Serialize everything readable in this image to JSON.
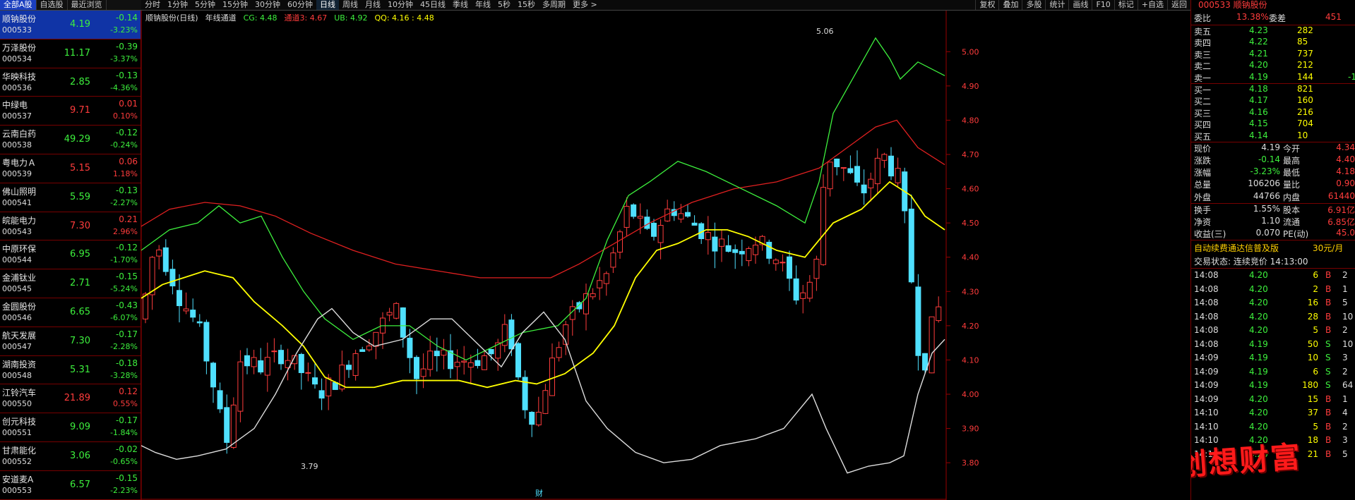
{
  "tabs": [
    "全部A股",
    "自选股",
    "最近浏览"
  ],
  "stocks": [
    {
      "name": "顺钠股份",
      "code": "000533",
      "price": "4.19",
      "chg": "-0.14",
      "pct": "-3.23%",
      "dir": "g",
      "sel": true
    },
    {
      "name": "万泽股份",
      "code": "000534",
      "price": "11.17",
      "chg": "-0.39",
      "pct": "-3.37%",
      "dir": "g"
    },
    {
      "name": "华映科技",
      "code": "000536",
      "price": "2.85",
      "chg": "-0.13",
      "pct": "-4.36%",
      "dir": "g"
    },
    {
      "name": "中绿电",
      "code": "000537",
      "price": "9.71",
      "chg": "0.01",
      "pct": "0.10%",
      "dir": "r"
    },
    {
      "name": "云南白药",
      "code": "000538",
      "price": "49.29",
      "chg": "-0.12",
      "pct": "-0.24%",
      "dir": "g"
    },
    {
      "name": "粤电力Ａ",
      "code": "000539",
      "price": "5.15",
      "chg": "0.06",
      "pct": "1.18%",
      "dir": "r"
    },
    {
      "name": "佛山照明",
      "code": "000541",
      "price": "5.59",
      "chg": "-0.13",
      "pct": "-2.27%",
      "dir": "g"
    },
    {
      "name": "皖能电力",
      "code": "000543",
      "price": "7.30",
      "chg": "0.21",
      "pct": "2.96%",
      "dir": "r"
    },
    {
      "name": "中原环保",
      "code": "000544",
      "price": "6.95",
      "chg": "-0.12",
      "pct": "-1.70%",
      "dir": "g"
    },
    {
      "name": "金浦钛业",
      "code": "000545",
      "price": "2.71",
      "chg": "-0.15",
      "pct": "-5.24%",
      "dir": "g"
    },
    {
      "name": "金圆股份",
      "code": "000546",
      "price": "6.65",
      "chg": "-0.43",
      "pct": "-6.07%",
      "dir": "g"
    },
    {
      "name": "航天发展",
      "code": "000547",
      "price": "7.30",
      "chg": "-0.17",
      "pct": "-2.28%",
      "dir": "g"
    },
    {
      "name": "湖南投资",
      "code": "000548",
      "price": "5.31",
      "chg": "-0.18",
      "pct": "-3.28%",
      "dir": "g"
    },
    {
      "name": "江铃汽车",
      "code": "000550",
      "price": "21.89",
      "chg": "0.12",
      "pct": "0.55%",
      "dir": "r"
    },
    {
      "name": "创元科技",
      "code": "000551",
      "price": "9.09",
      "chg": "-0.17",
      "pct": "-1.84%",
      "dir": "g"
    },
    {
      "name": "甘肃能化",
      "code": "000552",
      "price": "3.06",
      "chg": "-0.02",
      "pct": "-0.65%",
      "dir": "g"
    },
    {
      "name": "安道麦A",
      "code": "000553",
      "price": "6.57",
      "chg": "-0.15",
      "pct": "-2.23%",
      "dir": "g"
    }
  ],
  "toolbar": {
    "periods": [
      "分时",
      "1分钟",
      "5分钟",
      "15分钟",
      "30分钟",
      "60分钟",
      "日线",
      "周线",
      "月线",
      "10分钟",
      "45日线",
      "季线",
      "年线",
      "5秒",
      "15秒",
      "多周期",
      "更多 >"
    ],
    "active": "日线",
    "right": [
      "复权",
      "叠加",
      "多股",
      "统计",
      "画线",
      "F10",
      "标记",
      "+自选",
      "返回"
    ]
  },
  "legend": {
    "title": "顺钠股份(日线)",
    "indicator": "年线通道",
    "cg": "CG: 4.48",
    "lb": "通道3: 4.67",
    "ub": "UB: 4.92",
    "qq": "QQ: 4.16 : 4.48"
  },
  "chart_data": {
    "type": "candlestick",
    "ylim": [
      3.72,
      5.12
    ],
    "yticks": [
      "5.00",
      "4.90",
      "4.80",
      "4.70",
      "4.60",
      "4.50",
      "4.40",
      "4.30",
      "4.20",
      "4.10",
      "4.00",
      "3.90",
      "3.80"
    ],
    "high_label": "5.06",
    "low_label": "3.79",
    "bottom_label": "财",
    "series": [
      "CG",
      "通道3",
      "UB",
      "QQ"
    ]
  },
  "quote": {
    "title": "000533 顺钠股份",
    "weibi_label": "委比",
    "weibi": "13.38%",
    "weicha_label": "委差",
    "weicha": "451",
    "sells": [
      [
        "卖五",
        "4.23",
        "282",
        ""
      ],
      [
        "卖四",
        "4.22",
        "85",
        ""
      ],
      [
        "卖三",
        "4.21",
        "737",
        ""
      ],
      [
        "卖二",
        "4.20",
        "212",
        ""
      ],
      [
        "卖一",
        "4.19",
        "144",
        "-1"
      ]
    ],
    "buys": [
      [
        "买一",
        "4.18",
        "821",
        ""
      ],
      [
        "买二",
        "4.17",
        "160",
        ""
      ],
      [
        "买三",
        "4.16",
        "216",
        ""
      ],
      [
        "买四",
        "4.15",
        "704",
        ""
      ],
      [
        "买五",
        "4.14",
        "10",
        ""
      ]
    ],
    "stats": [
      [
        "现价",
        "4.19",
        "今开",
        "4.34"
      ],
      [
        "涨跌",
        "-0.14",
        "最高",
        "4.40"
      ],
      [
        "涨幅",
        "-3.23%",
        "最低",
        "4.18"
      ],
      [
        "总量",
        "106206",
        "量比",
        "0.90"
      ],
      [
        "外盘",
        "44766",
        "内盘",
        "61440"
      ]
    ],
    "stats2": [
      [
        "换手",
        "1.55%",
        "股本",
        "6.91亿"
      ],
      [
        "净资",
        "1.10",
        "流通",
        "6.85亿"
      ],
      [
        "收益(三)",
        "0.070",
        "PE(动)",
        "45.0"
      ]
    ],
    "ad": "自动续费通达信普及版",
    "ad_price": "30元/月",
    "status": "交易状态: 连续竞价 14:13:00",
    "ticks": [
      [
        "14:08",
        "4.20",
        "6",
        "B",
        "2"
      ],
      [
        "14:08",
        "4.20",
        "2",
        "B",
        "1"
      ],
      [
        "14:08",
        "4.20",
        "16",
        "B",
        "5"
      ],
      [
        "14:08",
        "4.20",
        "28",
        "B",
        "10"
      ],
      [
        "14:08",
        "4.20",
        "5",
        "B",
        "2"
      ],
      [
        "14:08",
        "4.19",
        "50",
        "S",
        "10"
      ],
      [
        "14:09",
        "4.19",
        "10",
        "S",
        "3"
      ],
      [
        "14:09",
        "4.19",
        "6",
        "S",
        "2"
      ],
      [
        "14:09",
        "4.19",
        "180",
        "S",
        "64"
      ],
      [
        "14:09",
        "4.20",
        "15",
        "B",
        "1"
      ],
      [
        "14:10",
        "4.20",
        "37",
        "B",
        "4"
      ],
      [
        "14:10",
        "4.20",
        "5",
        "B",
        "2"
      ],
      [
        "14:10",
        "4.20",
        "18",
        "B",
        "3"
      ],
      [
        "14:10",
        "4.20",
        "21",
        "B",
        "5"
      ]
    ],
    "watermark": "创想财富"
  }
}
